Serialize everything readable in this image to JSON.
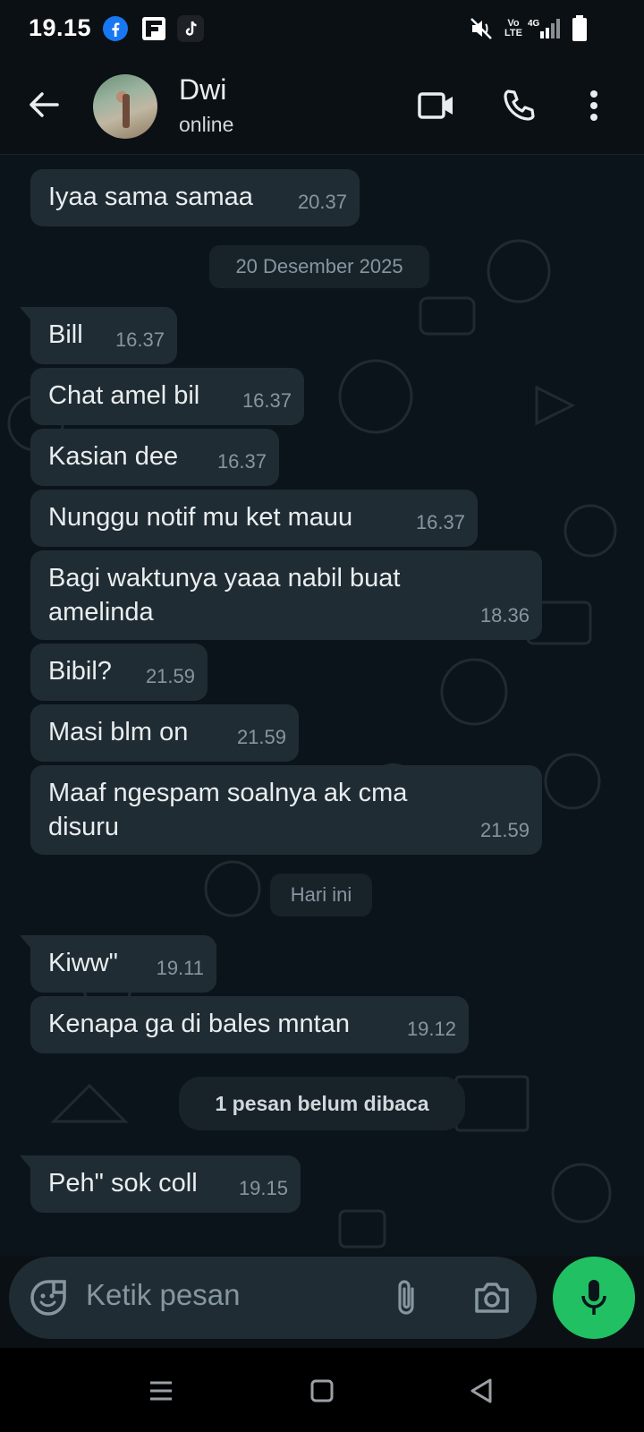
{
  "status_bar": {
    "time": "19.15",
    "icons": [
      "facebook-icon",
      "flipboard-icon",
      "tiktok-icon",
      "mute-icon",
      "volte-icon",
      "4g-signal-icon",
      "battery-icon"
    ],
    "network_label": "Vo LTE"
  },
  "header": {
    "contact_name": "Dwi",
    "contact_status": "online"
  },
  "messages": [
    {
      "text": "Iyaa sama samaa",
      "time": "20.37"
    },
    {
      "text": "Bill",
      "time": "16.37"
    },
    {
      "text": "Chat amel bil",
      "time": "16.37"
    },
    {
      "text": "Kasian dee",
      "time": "16.37"
    },
    {
      "text": "Nunggu notif mu ket mauu",
      "time": "16.37"
    },
    {
      "text": "Bagi waktunya yaaa nabil buat amelinda",
      "time": "18.36"
    },
    {
      "text": "Bibil?",
      "time": "21.59"
    },
    {
      "text": "Masi blm on",
      "time": "21.59"
    },
    {
      "text": "Maaf ngespam soalnya ak cma disuru",
      "time": "21.59"
    },
    {
      "text": "Kiww\"",
      "time": "19.11"
    },
    {
      "text": "Kenapa ga di bales mntan",
      "time": "19.12"
    },
    {
      "text": "Peh\" sok coll",
      "time": "19.15"
    }
  ],
  "date_separators": [
    "20 Desember 2025",
    "Hari ini"
  ],
  "unread_banner": "1 pesan belum dibaca",
  "composer": {
    "placeholder": "Ketik pesan"
  },
  "colors": {
    "background": "#0b141a",
    "bubble_incoming": "#202c33",
    "accent_green": "#21c063",
    "timestamp": "#8696a0"
  }
}
